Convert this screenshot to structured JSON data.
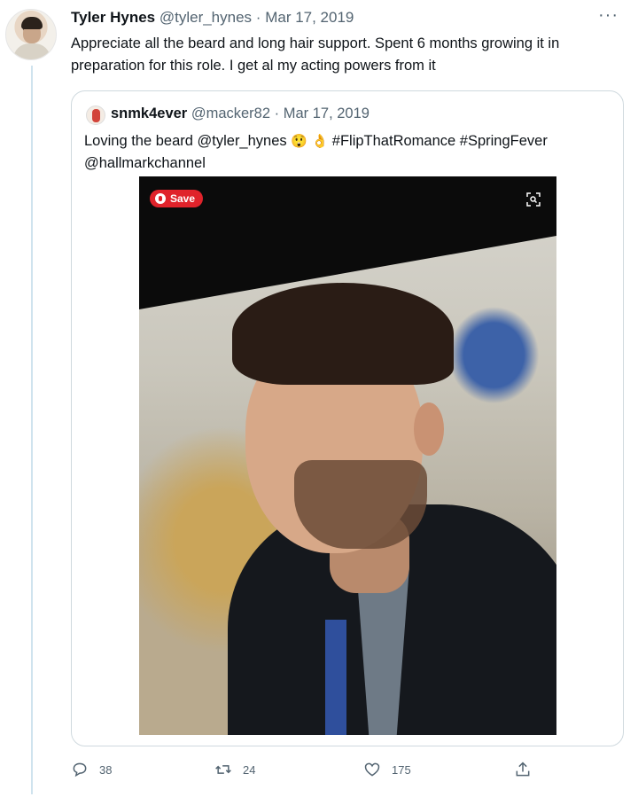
{
  "tweet": {
    "author_name": "Tyler Hynes",
    "author_handle": "@tyler_hynes",
    "separator": "·",
    "date": "Mar 17, 2019",
    "more_label": "···",
    "text": "Appreciate all the beard and long hair support. Spent 6 months growing it in preparation for this role. I get al my acting powers from it"
  },
  "quote": {
    "author_name": "snmk4ever",
    "author_handle": "@macker82",
    "separator": "·",
    "date": "Mar 17, 2019",
    "text_before": "Loving the beard @tyler_hynes ",
    "emoji1": "😲",
    "emoji2": "👌",
    "text_after": " #FlipThatRomance #SpringFever @hallmarkchannel",
    "photo": {
      "save_label": "Save",
      "icons": [
        "pinterest-icon",
        "visual-search-icon"
      ]
    }
  },
  "actions": {
    "reply_count": "38",
    "retweet_count": "24",
    "like_count": "175"
  },
  "colors": {
    "thread_line": "#cfe3ee",
    "secondary_text": "#536471",
    "border": "#cfd9de",
    "save_red": "#e0232b"
  }
}
